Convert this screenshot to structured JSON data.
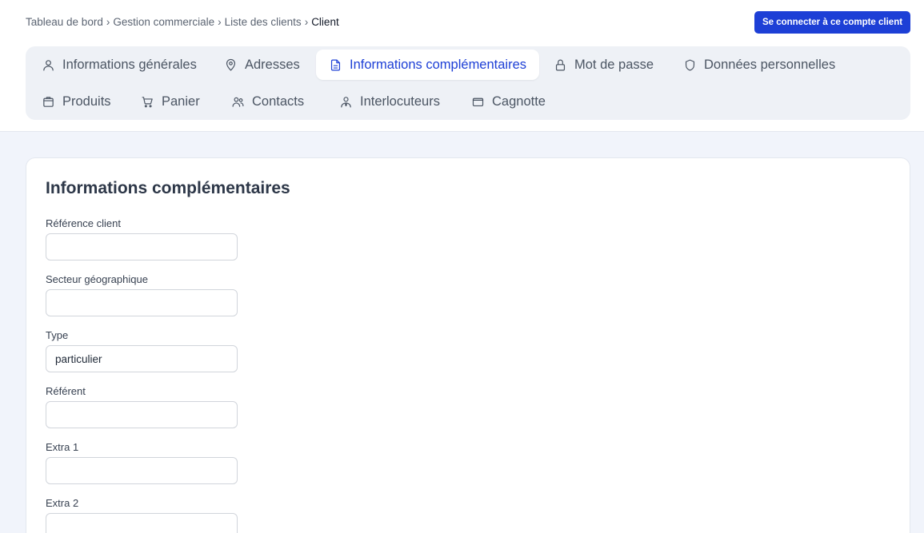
{
  "breadcrumb": {
    "items": [
      "Tableau de bord",
      "Gestion commerciale",
      "Liste des clients"
    ],
    "separator": "›",
    "current": "Client"
  },
  "header": {
    "connect_button": "Se connecter à ce compte client"
  },
  "tabs": [
    {
      "label": "Informations générales",
      "icon": "user-icon",
      "active": false
    },
    {
      "label": "Adresses",
      "icon": "map-pin-icon",
      "active": false
    },
    {
      "label": "Informations complémentaires",
      "icon": "document-icon",
      "active": true
    },
    {
      "label": "Mot de passe",
      "icon": "lock-icon",
      "active": false
    },
    {
      "label": "Données personnelles",
      "icon": "shield-icon",
      "active": false
    },
    {
      "label": "Produits",
      "icon": "box-icon",
      "active": false
    },
    {
      "label": "Panier",
      "icon": "cart-icon",
      "active": false
    },
    {
      "label": "Contacts",
      "icon": "users-icon",
      "active": false
    },
    {
      "label": "Interlocuteurs",
      "icon": "user-tie-icon",
      "active": false
    },
    {
      "label": "Cagnotte",
      "icon": "wallet-icon",
      "active": false
    }
  ],
  "form": {
    "title": "Informations complémentaires",
    "fields": [
      {
        "label": "Référence client",
        "value": ""
      },
      {
        "label": "Secteur géographique",
        "value": ""
      },
      {
        "label": "Type",
        "value": "particulier"
      },
      {
        "label": "Référent",
        "value": ""
      },
      {
        "label": "Extra 1",
        "value": ""
      },
      {
        "label": "Extra 2",
        "value": ""
      }
    ]
  },
  "colors": {
    "accent": "#1d3fd6",
    "page_background": "#f1f4fb",
    "tab_bar_background": "#eef1f6"
  }
}
